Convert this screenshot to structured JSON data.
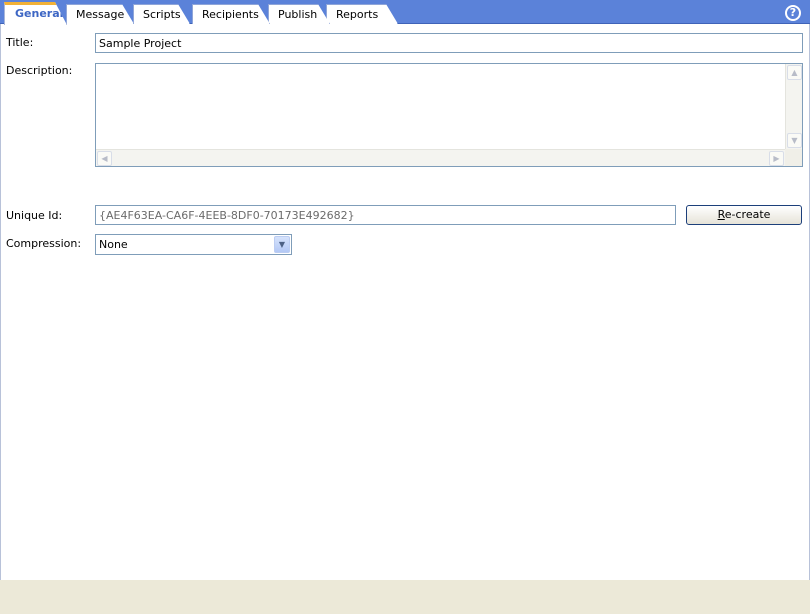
{
  "tabs": [
    {
      "label": "General",
      "active": true
    },
    {
      "label": "Message",
      "active": false
    },
    {
      "label": "Scripts",
      "active": false
    },
    {
      "label": "Recipients",
      "active": false
    },
    {
      "label": "Publish",
      "active": false
    },
    {
      "label": "Reports",
      "active": false
    }
  ],
  "help": {
    "glyph": "?",
    "icon": "help-icon"
  },
  "form": {
    "title_label": "Title:",
    "title_value": "Sample Project",
    "description_label": "Description:",
    "description_value": "",
    "unique_id_label": "Unique Id:",
    "unique_id_value": "{AE4F63EA-CA6F-4EEB-8DF0-70173E492682}",
    "recreate_button": {
      "mnemonic": "R",
      "rest": "e-create"
    },
    "compression_label": "Compression:",
    "compression_value": "None"
  },
  "colors": {
    "tabbar": "#5b82d9",
    "active_tab_accent": "#f2b136",
    "active_tab_text": "#3d66c4",
    "statusbar": "#ece9d8"
  }
}
